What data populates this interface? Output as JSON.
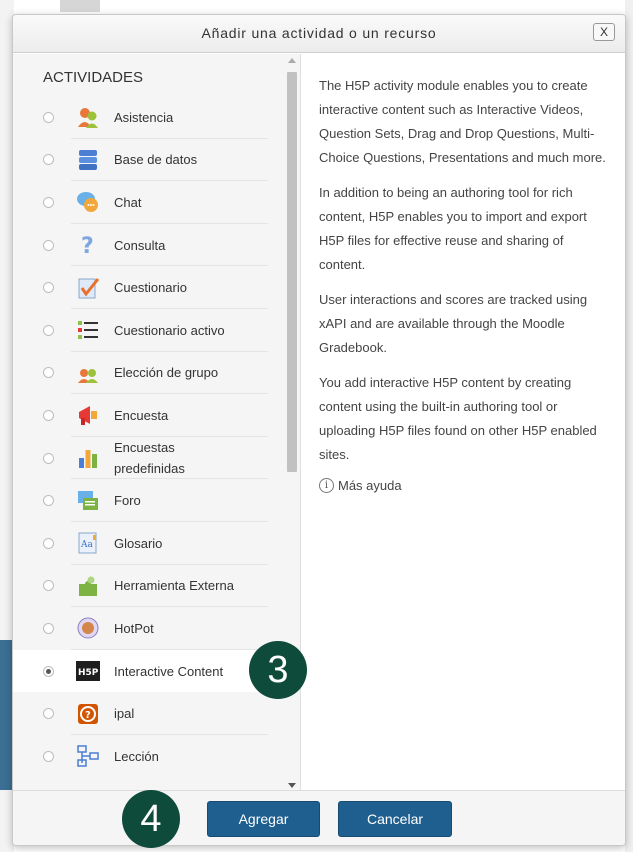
{
  "dialog": {
    "title": "Añadir una actividad o un recurso",
    "close_label": "X"
  },
  "activities": {
    "heading": "ACTIVIDADES",
    "items": [
      {
        "label": "Asistencia",
        "icon": "attendance-icon",
        "selected": false
      },
      {
        "label": "Base de datos",
        "icon": "database-icon",
        "selected": false
      },
      {
        "label": "Chat",
        "icon": "chat-icon",
        "selected": false
      },
      {
        "label": "Consulta",
        "icon": "question-icon",
        "selected": false
      },
      {
        "label": "Cuestionario",
        "icon": "quiz-icon",
        "selected": false
      },
      {
        "label": "Cuestionario activo",
        "icon": "active-quiz-icon",
        "selected": false
      },
      {
        "label": "Elección de grupo",
        "icon": "group-choice-icon",
        "selected": false
      },
      {
        "label": "Encuesta",
        "icon": "megaphone-icon",
        "selected": false
      },
      {
        "label": "Encuestas predefinidas",
        "icon": "chart-icon",
        "selected": false
      },
      {
        "label": "Foro",
        "icon": "forum-icon",
        "selected": false
      },
      {
        "label": "Glosario",
        "icon": "glossary-icon",
        "selected": false
      },
      {
        "label": "Herramienta Externa",
        "icon": "puzzle-icon",
        "selected": false
      },
      {
        "label": "HotPot",
        "icon": "hotpot-icon",
        "selected": false
      },
      {
        "label": "Interactive Content",
        "icon": "h5p-icon",
        "selected": true
      },
      {
        "label": "ipal",
        "icon": "ipal-icon",
        "selected": false
      },
      {
        "label": "Lección",
        "icon": "lesson-icon",
        "selected": false
      }
    ]
  },
  "description": {
    "paragraphs": [
      "The H5P activity module enables you to create interactive content such as Interactive Videos, Question Sets, Drag and Drop Questions, Multi-Choice Questions, Presentations and much more.",
      "In addition to being an authoring tool for rich content, H5P enables you to import and export H5P files for effective reuse and sharing of content.",
      "User interactions and scores are tracked using xAPI and are available through the Moodle Gradebook.",
      "You add interactive H5P content by creating content using the built-in authoring tool or uploading H5P files found on other H5P enabled sites."
    ],
    "more_help": "Más ayuda"
  },
  "footer": {
    "add_label": "Agregar",
    "cancel_label": "Cancelar"
  },
  "markers": {
    "step3": "3",
    "step4": "4"
  }
}
